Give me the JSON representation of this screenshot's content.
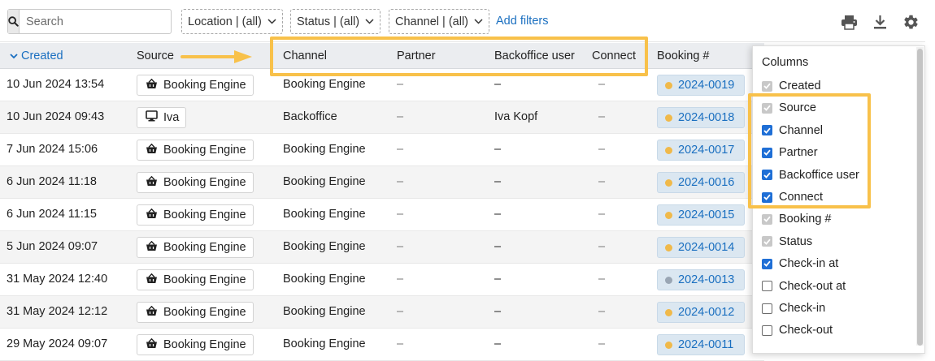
{
  "toolbar": {
    "search_placeholder": "Search",
    "filters": [
      {
        "label": "Location | (all)"
      },
      {
        "label": "Status | (all)"
      },
      {
        "label": "Channel | (all)"
      }
    ],
    "add_filters_label": "Add filters",
    "icons": [
      "search-icon",
      "printer-icon",
      "download-icon",
      "gear-icon"
    ]
  },
  "table": {
    "headers": {
      "created": "Created",
      "source": "Source",
      "channel": "Channel",
      "partner": "Partner",
      "backoffice_user": "Backoffice user",
      "connect": "Connect",
      "booking": "Booking #"
    },
    "sort": {
      "column": "created",
      "direction": "descending",
      "icon": "chevron-down-icon"
    },
    "rows": [
      {
        "created": "10 Jun 2024 13:54",
        "source": "Booking Engine",
        "source_icon": "basket-icon",
        "channel": "Booking Engine",
        "partner": "–",
        "backoffice_user": "–",
        "connect": "–",
        "booking": "2024-0019",
        "status_color": "#f0b94a"
      },
      {
        "created": "10 Jun 2024 09:43",
        "source": "Iva",
        "source_icon": "monitor-icon",
        "channel": "Backoffice",
        "partner": "–",
        "backoffice_user": "Iva Kopf",
        "connect": "–",
        "booking": "2024-0018",
        "status_color": "#f0b94a"
      },
      {
        "created": "7 Jun 2024 15:06",
        "source": "Booking Engine",
        "source_icon": "basket-icon",
        "channel": "Booking Engine",
        "partner": "–",
        "backoffice_user": "–",
        "connect": "–",
        "booking": "2024-0017",
        "status_color": "#f0b94a"
      },
      {
        "created": "6 Jun 2024 11:18",
        "source": "Booking Engine",
        "source_icon": "basket-icon",
        "channel": "Booking Engine",
        "partner": "–",
        "backoffice_user": "–",
        "connect": "–",
        "booking": "2024-0016",
        "status_color": "#f0b94a"
      },
      {
        "created": "6 Jun 2024 11:15",
        "source": "Booking Engine",
        "source_icon": "basket-icon",
        "channel": "Booking Engine",
        "partner": "–",
        "backoffice_user": "–",
        "connect": "–",
        "booking": "2024-0015",
        "status_color": "#f0b94a"
      },
      {
        "created": "5 Jun 2024 09:07",
        "source": "Booking Engine",
        "source_icon": "basket-icon",
        "channel": "Booking Engine",
        "partner": "–",
        "backoffice_user": "–",
        "connect": "–",
        "booking": "2024-0014",
        "status_color": "#f0b94a"
      },
      {
        "created": "31 May 2024 12:40",
        "source": "Booking Engine",
        "source_icon": "basket-icon",
        "channel": "Booking Engine",
        "partner": "–",
        "backoffice_user": "–",
        "connect": "–",
        "booking": "2024-0013",
        "status_color": "#9aa6b4"
      },
      {
        "created": "31 May 2024 12:12",
        "source": "Booking Engine",
        "source_icon": "basket-icon",
        "channel": "Booking Engine",
        "partner": "–",
        "backoffice_user": "–",
        "connect": "–",
        "booking": "2024-0012",
        "status_color": "#f0b94a"
      },
      {
        "created": "29 May 2024 09:07",
        "source": "Booking Engine",
        "source_icon": "basket-icon",
        "channel": "Booking Engine",
        "partner": "–",
        "backoffice_user": "–",
        "connect": "–",
        "booking": "2024-0011",
        "status_color": "#f0b94a"
      }
    ]
  },
  "columns_panel": {
    "title": "Columns",
    "options": [
      {
        "label": "Created",
        "state": "disabled"
      },
      {
        "label": "Source",
        "state": "disabled"
      },
      {
        "label": "Channel",
        "state": "checked"
      },
      {
        "label": "Partner",
        "state": "checked"
      },
      {
        "label": "Backoffice user",
        "state": "checked"
      },
      {
        "label": "Connect",
        "state": "checked"
      },
      {
        "label": "Booking #",
        "state": "disabled"
      },
      {
        "label": "Status",
        "state": "disabled"
      },
      {
        "label": "Check-in at",
        "state": "checked"
      },
      {
        "label": "Check-out at",
        "state": "unchecked"
      },
      {
        "label": "Check-in",
        "state": "unchecked"
      },
      {
        "label": "Check-out",
        "state": "unchecked"
      }
    ]
  },
  "colors": {
    "accent": "#1a6fc0",
    "highlight": "#f8c14a",
    "checkbox_on": "#1f6fd6",
    "checkbox_disabled": "#c8c8c8"
  }
}
